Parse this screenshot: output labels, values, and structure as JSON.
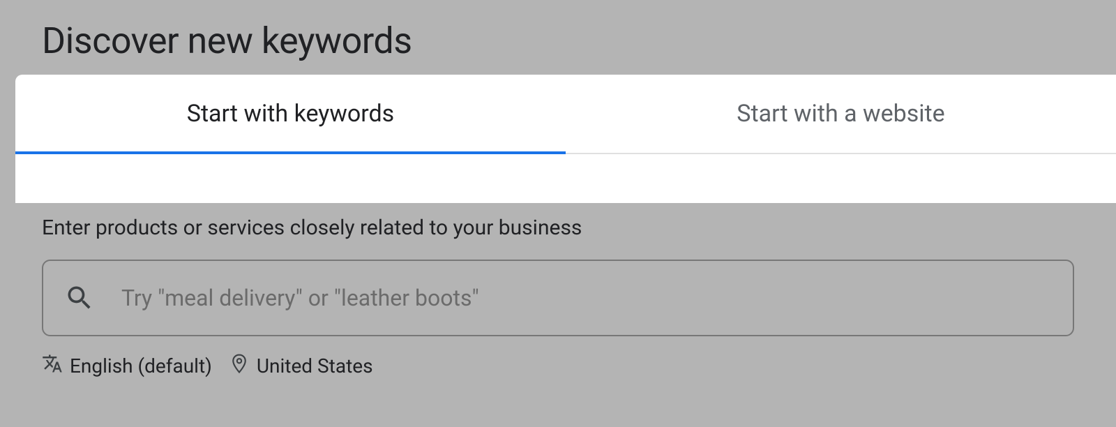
{
  "header": {
    "title": "Discover new keywords"
  },
  "tabs": [
    {
      "label": "Start with keywords",
      "active": true
    },
    {
      "label": "Start with a website",
      "active": false
    }
  ],
  "form": {
    "instruction": "Enter products or services closely related to your business",
    "search": {
      "placeholder": "Try \"meal delivery\" or \"leather boots\"",
      "value": ""
    }
  },
  "settings": {
    "language": "English (default)",
    "location": "United States"
  }
}
